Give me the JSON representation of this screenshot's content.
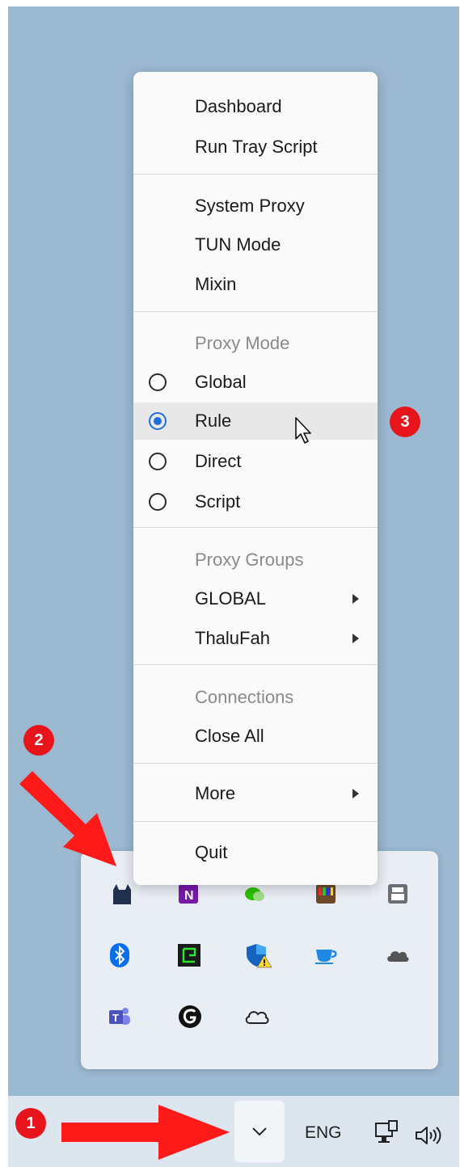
{
  "menu": {
    "dashboard": "Dashboard",
    "run_tray_script": "Run Tray Script",
    "system_proxy": "System Proxy",
    "tun_mode": "TUN Mode",
    "mixin": "Mixin",
    "proxy_mode_header": "Proxy Mode",
    "mode_global": "Global",
    "mode_rule": "Rule",
    "mode_direct": "Direct",
    "mode_script": "Script",
    "selected_mode": "Rule",
    "proxy_groups_header": "Proxy Groups",
    "group_global": "GLOBAL",
    "group_thalufah": "ThaluFah",
    "connections_header": "Connections",
    "close_all": "Close All",
    "more": "More",
    "quit": "Quit"
  },
  "badges": {
    "one": "1",
    "two": "2",
    "three": "3"
  },
  "taskbar": {
    "language": "ENG"
  },
  "tray_icons": [
    "clash-cat-icon",
    "onenote-icon",
    "wechat-icon",
    "color-app-icon",
    "printer-icon",
    "bluetooth-icon",
    "gpu-monitor-icon",
    "defender-warning-icon",
    "coffee-cup-icon",
    "cloud-dark-icon",
    "teams-icon",
    "g-hub-icon",
    "onedrive-icon"
  ],
  "colors": {
    "badge": "#e8141b",
    "radio_checked": "#1f6fd9",
    "desktop": "#9cb9d2",
    "arrow": "#ff1a1a"
  }
}
